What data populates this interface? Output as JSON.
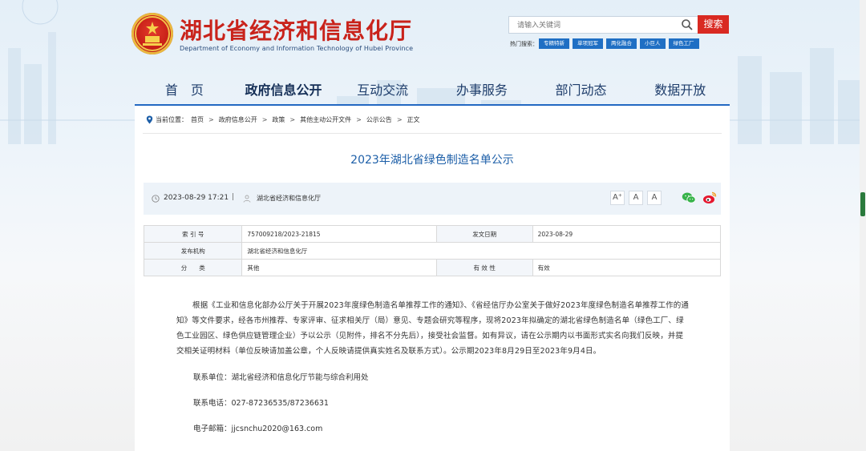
{
  "header": {
    "title": "湖北省经济和信息化厅",
    "subtitle": "Department of Economy and Information Technology of Hubei Province",
    "search_placeholder": "请输入关键词",
    "search_button": "搜索",
    "hot_label": "热门搜索：",
    "hot_tags": [
      "专精特新",
      "单项冠军",
      "两化融合",
      "小巨人",
      "绿色工厂"
    ]
  },
  "nav": {
    "items": [
      {
        "label": "首　页"
      },
      {
        "label": "政府信息公开"
      },
      {
        "label": "互动交流"
      },
      {
        "label": "办事服务"
      },
      {
        "label": "部门动态"
      },
      {
        "label": "数据开放"
      }
    ]
  },
  "breadcrumb": {
    "label": "当前位置：",
    "items": [
      "首页",
      "政府信息公开",
      "政策",
      "其他主动公开文件",
      "公示公告",
      "正文"
    ]
  },
  "article": {
    "title": "2023年湖北省绿色制造名单公示",
    "date": "2023-08-29 17:21",
    "separator": "|",
    "source": "湖北省经济和信息化厅",
    "font_buttons": [
      "A⁺",
      "A",
      "A"
    ]
  },
  "meta": {
    "index_label": "索 引 号",
    "index_value": "757009218/2023-21815",
    "date_label": "发文日期",
    "date_value": "2023-08-29",
    "publisher_label": "发布机构",
    "publisher_value": "湖北省经济和信息化厅",
    "category_label": "分　　类",
    "category_value": "其他",
    "validity_label": "有 效 性",
    "validity_value": "有效"
  },
  "body": {
    "paragraph": "根据《工业和信息化部办公厅关于开展2023年度绿色制造名单推荐工作的通知》、《省经信厅办公室关于做好2023年度绿色制造名单推荐工作的通知》等文件要求，经各市州推荐、专家评审、征求相关厅（局）意见、专题会研究等程序，现将2023年拟确定的湖北省绿色制造名单（绿色工厂、绿色工业园区、绿色供应链管理企业）予以公示（见附件，排名不分先后），接受社会监督。如有异议，请在公示期内以书面形式实名向我们反映，并提交相关证明材料（单位反映请加盖公章，个人反映请提供真实姓名及联系方式）。公示期2023年8月29日至2023年9月4日。",
    "contact_unit": "联系单位：湖北省经济和信息化厅节能与综合利用处",
    "contact_phone": "联系电话：027-87236535/87236631",
    "contact_email": "电子邮箱：jjcsnchu2020@163.com"
  },
  "colors": {
    "brand_red": "#c9231b",
    "nav_blue": "#2368c2",
    "title_blue": "#1d5fa8",
    "tag_blue": "#1f6fc4"
  }
}
